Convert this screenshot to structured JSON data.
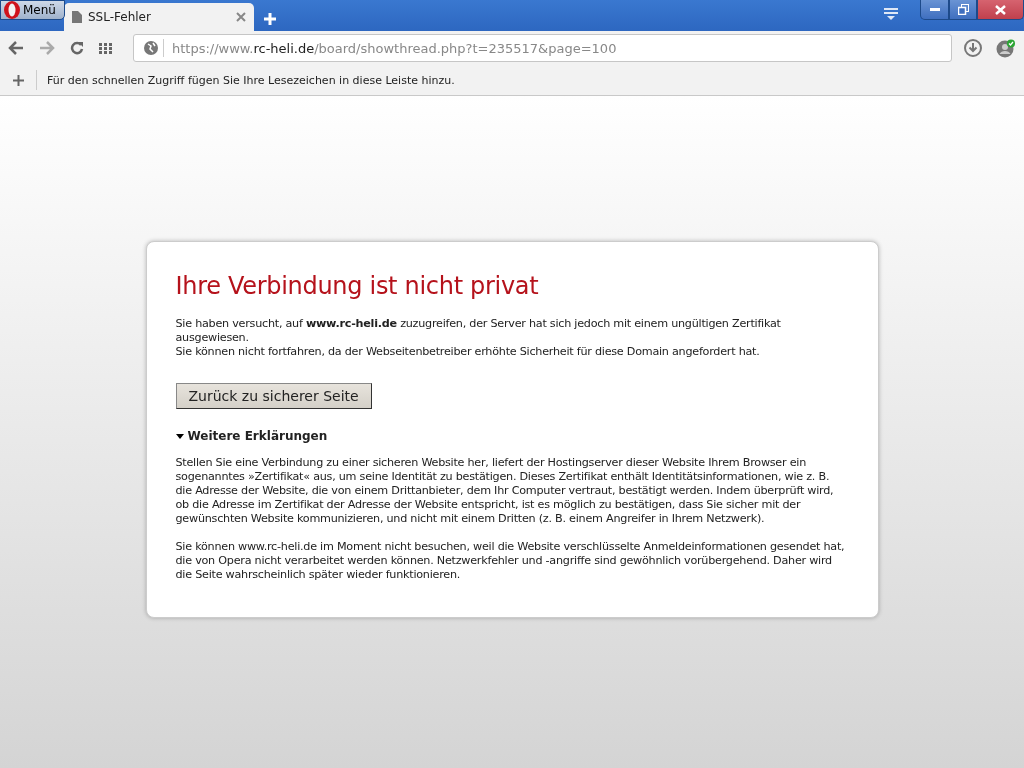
{
  "menu_button": {
    "label": "Menü"
  },
  "tabs": [
    {
      "title": "SSL-Fehler",
      "selected": true
    }
  ],
  "address_bar": {
    "prefix": "https://www.",
    "host": "rc-heli.de",
    "path": "/board/showthread.php?t=235517&page=100"
  },
  "bookmarks_bar": {
    "hint": "Für den schnellen Zugriff fügen Sie Ihre Lesezeichen in diese Leiste hinzu."
  },
  "error": {
    "heading": "Ihre Verbindung ist nicht privat",
    "intro": [
      "Sie haben versucht, auf **www.rc-heli.de** zuzugreifen, der Server hat sich jedoch mit einem ungültigen Zertifikat ausgewiesen.",
      "Sie können nicht fortfahren, da der Webseitenbetreiber erhöhte Sicherheit für diese Domain angefordert hat."
    ],
    "back_button": "Zurück zu sicherer Seite",
    "details": {
      "label": "Weitere Erklärungen",
      "expanded": true,
      "paragraphs": [
        "Stellen Sie eine Verbindung zu einer sicheren Website her, liefert der Hostingserver dieser Website Ihrem Browser ein sogenanntes »Zertifikat« aus, um seine Identität zu bestätigen. Dieses Zertifikat enthält Identitätsinformationen, wie z. B. die Adresse der Website, die von einem Drittanbieter, dem Ihr Computer vertraut, bestätigt werden. Indem überprüft wird, ob die Adresse im Zertifikat der Adresse der Website entspricht, ist es möglich zu bestätigen, dass Sie sicher mit der gewünschten Website kommunizieren, und nicht mit einem Dritten (z. B. einem Angreifer in Ihrem Netzwerk).",
        "Sie können www.rc-heli.de im Moment nicht besuchen, weil die Website verschlüsselte Anmeldeinformationen gesendet hat, die von Opera nicht verarbeitet werden können. Netzwerkfehler und -angriffe sind gewöhnlich vorübergehend. Daher wird die Seite wahrscheinlich später wieder funktionieren."
      ]
    }
  }
}
